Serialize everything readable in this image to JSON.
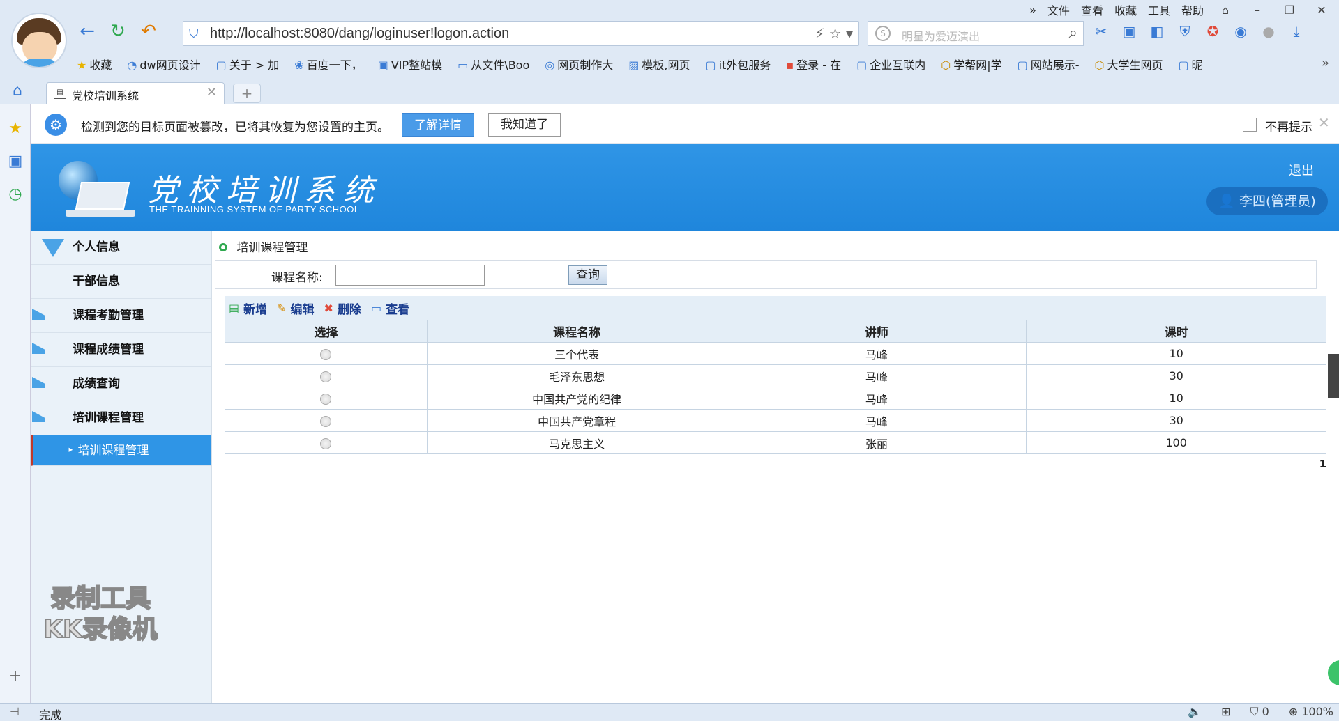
{
  "browser": {
    "top_menu": [
      "文件",
      "查看",
      "收藏",
      "工具",
      "帮助"
    ],
    "address": "http://localhost:8080/dang/loginuser!logon.action",
    "search_placeholder": "明星为爱迈演出",
    "bookmarks": [
      "收藏",
      "dw网页设计",
      "关于 > 加",
      "百度一下，",
      "VIP整站模",
      "从文件\\Boo",
      "网页制作大",
      "模板,网页",
      "it外包服务",
      "登录 - 在",
      "企业互联内",
      "学帮网|学",
      "网站展示-",
      "大学生网页",
      "昵"
    ],
    "tab_title": "党校培训系统",
    "status_text": "完成",
    "zoom": "100%",
    "counter": "0"
  },
  "notice": {
    "message": "检测到您的目标页面被篡改，已将其恢复为您设置的主页。",
    "learn_more": "了解详情",
    "got_it": "我知道了",
    "dont_remind": "不再提示"
  },
  "header": {
    "title": "党校培训系统",
    "subtitle": "THE TRAINNING SYSTEM OF PARTY SCHOOL",
    "logout": "退出",
    "user": "李四(管理员)",
    "brand_color": "#2f95e6"
  },
  "nav": {
    "items": [
      "个人信息",
      "干部信息",
      "课程考勤管理",
      "课程成绩管理",
      "成绩查询",
      "培训课程管理"
    ],
    "active_sub": "培训课程管理"
  },
  "content": {
    "breadcrumb": "培训课程管理",
    "query_label": "课程名称:",
    "query_value": "",
    "query_button": "查询",
    "toolbar": [
      "新增",
      "编辑",
      "删除",
      "查看"
    ],
    "columns": [
      "选择",
      "课程名称",
      "讲师",
      "课时"
    ],
    "rows": [
      {
        "name": "三个代表",
        "teacher": "马峰",
        "hours": "10"
      },
      {
        "name": "毛泽东思想",
        "teacher": "马峰",
        "hours": "30"
      },
      {
        "name": "中国共产党的纪律",
        "teacher": "马峰",
        "hours": "10"
      },
      {
        "name": "中国共产党章程",
        "teacher": "马峰",
        "hours": "30"
      },
      {
        "name": "马克思主义",
        "teacher": "张丽",
        "hours": "100"
      }
    ],
    "page": "1"
  },
  "watermark": {
    "line1": "录制工具",
    "line2": "KK录像机"
  }
}
